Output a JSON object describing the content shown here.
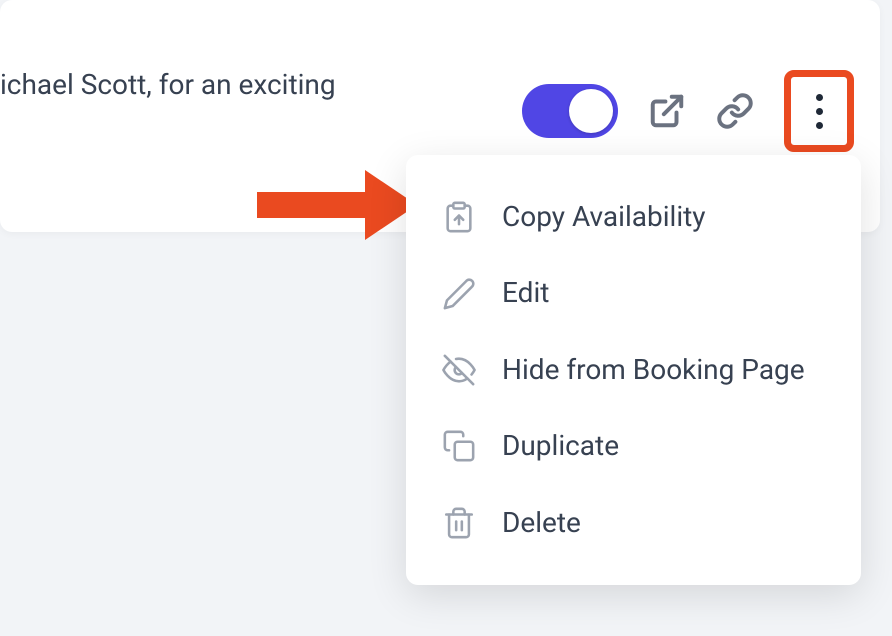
{
  "description_text": "ichael Scott, for an exciting",
  "toggle_on": true,
  "colors": {
    "accent": "#5046e5",
    "highlight": "#ea4a20",
    "text": "#374151",
    "icon": "#9ca3af"
  },
  "icons": {
    "external_link": "external-link-icon",
    "link": "link-icon",
    "more": "more-icon"
  },
  "menu": {
    "items": [
      {
        "icon": "clipboard-paste-icon",
        "label": "Copy Availability"
      },
      {
        "icon": "pencil-icon",
        "label": "Edit"
      },
      {
        "icon": "eye-off-icon",
        "label": "Hide from Booking Page"
      },
      {
        "icon": "copy-icon",
        "label": "Duplicate"
      },
      {
        "icon": "trash-icon",
        "label": "Delete"
      }
    ]
  }
}
